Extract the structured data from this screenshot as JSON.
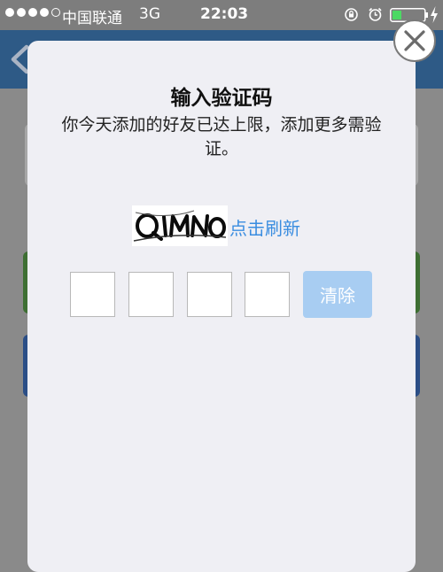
{
  "status_bar": {
    "carrier": "中国联通",
    "network": "3G",
    "time": "22:03",
    "signal_bars_filled": 4,
    "signal_bars_total": 5
  },
  "dialog": {
    "title": "输入验证码",
    "message": "你今天添加的好友已达上限，添加更多需验证。",
    "refresh_link": "点击刷新",
    "clear_button": "清除",
    "code_input_count": 4,
    "close_icon": "close-icon"
  },
  "colors": {
    "link_blue": "#3a8de0",
    "clear_button_bg": "#a8cdf2",
    "dialog_bg": "#efeff4"
  }
}
